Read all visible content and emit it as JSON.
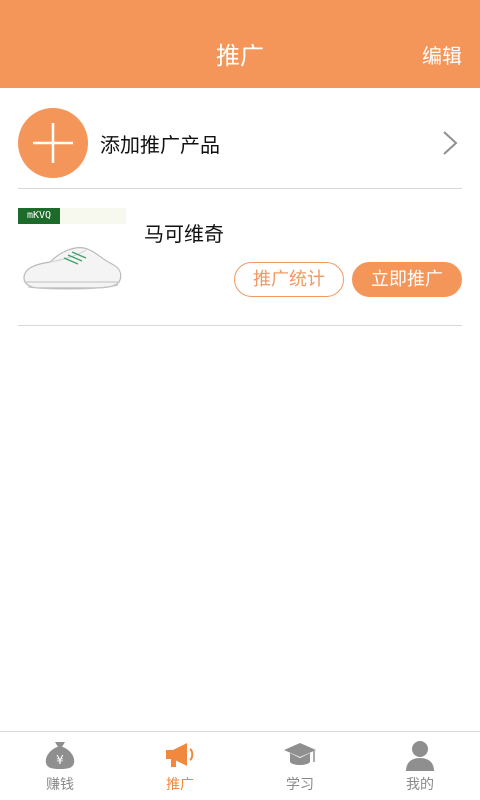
{
  "header": {
    "title": "推广",
    "edit_label": "编辑"
  },
  "add_product": {
    "label": "添加推广产品",
    "icon": "plus-icon"
  },
  "products": [
    {
      "name": "马可维奇",
      "brand_logo_text": "mKVQ",
      "stats_button": "推广统计",
      "promote_button": "立即推广"
    }
  ],
  "tabbar": {
    "items": [
      {
        "label": "赚钱",
        "icon": "money-bag-icon",
        "active": false
      },
      {
        "label": "推广",
        "icon": "megaphone-icon",
        "active": true
      },
      {
        "label": "学习",
        "icon": "graduation-cap-icon",
        "active": false
      },
      {
        "label": "我的",
        "icon": "user-icon",
        "active": false
      }
    ]
  },
  "colors": {
    "accent": "#f4965a",
    "inactive": "#8a8a8a",
    "divider": "#d8d8d8"
  }
}
